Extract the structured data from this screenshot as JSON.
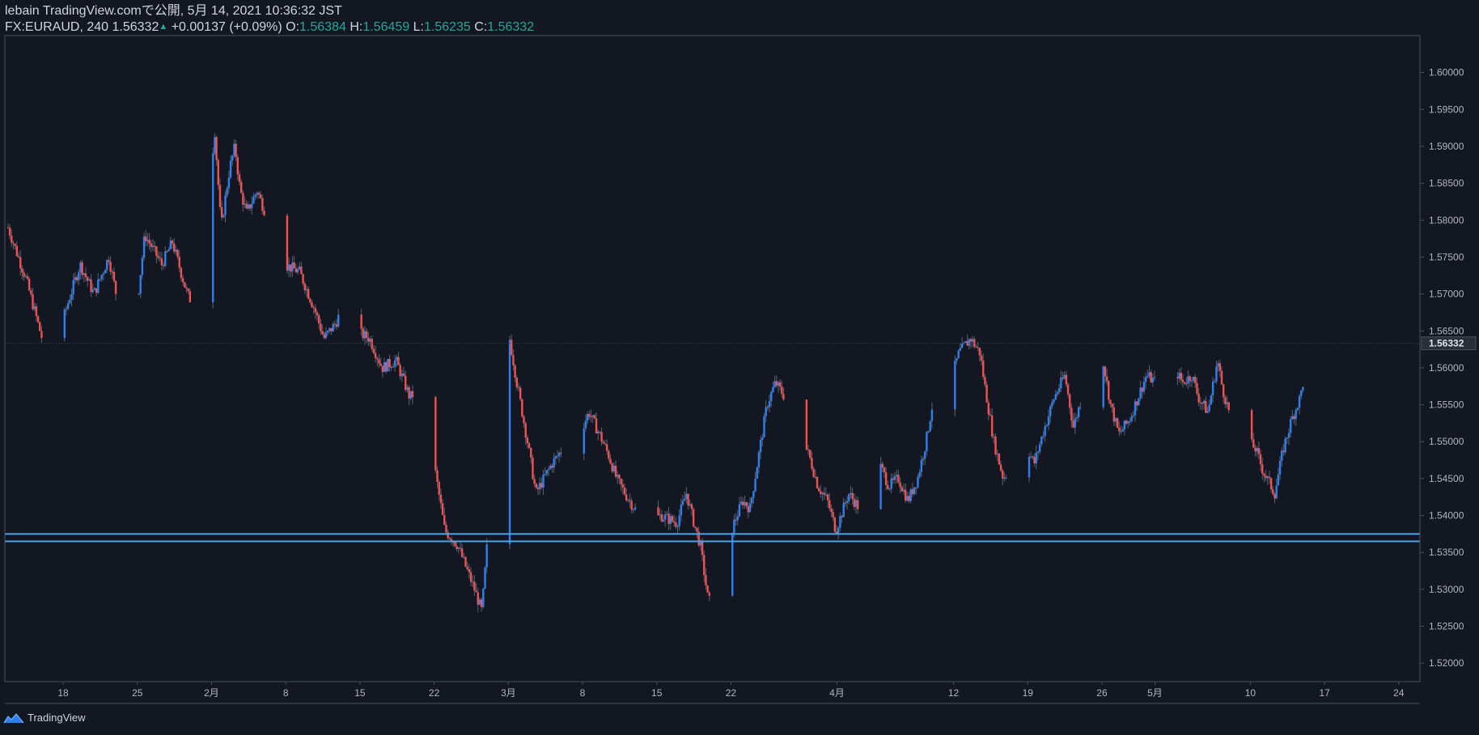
{
  "header": {
    "published": "lebain TradingView.comで公開, 5月 14, 2021 10:36:32 JST",
    "symbol": "FX:EURAUD, 240",
    "last": "1.56332",
    "change": "+0.00137 (+0.09%)",
    "o_label": "O:",
    "o_value": "1.56384",
    "h_label": "H:",
    "h_value": "1.56459",
    "l_label": "L:",
    "l_value": "1.56235",
    "c_label": "C:",
    "c_value": "1.56332"
  },
  "footer": {
    "brand": "TradingView",
    "logo_icon": "tradingview-logo-icon"
  },
  "colors": {
    "background": "#131722",
    "up": "#2f80ed",
    "down": "#ef5350",
    "support_line": "#4ca3e6",
    "axis_text": "#b2b5be",
    "border": "#4a4f5c"
  },
  "chart_data": {
    "type": "candlestick",
    "title": "",
    "ylim": [
      1.5175,
      1.605
    ],
    "y_ticks": [
      "1.60000",
      "1.59500",
      "1.59000",
      "1.58500",
      "1.58000",
      "1.57500",
      "1.57000",
      "1.56500",
      "1.56000",
      "1.55500",
      "1.55000",
      "1.54500",
      "1.54000",
      "1.53500",
      "1.53000",
      "1.52500",
      "1.52000"
    ],
    "last_price_label": "1.56332",
    "last_price": 1.56332,
    "x_ticks": [
      {
        "label": "18",
        "day": 18
      },
      {
        "label": "25",
        "day": 25
      },
      {
        "label": "2月",
        "day": 32
      },
      {
        "label": "8",
        "day": 39
      },
      {
        "label": "15",
        "day": 46
      },
      {
        "label": "22",
        "day": 53
      },
      {
        "label": "3月",
        "day": 60
      },
      {
        "label": "8",
        "day": 67
      },
      {
        "label": "15",
        "day": 74
      },
      {
        "label": "22",
        "day": 81
      },
      {
        "label": "4月",
        "day": 91
      },
      {
        "label": "12",
        "day": 102
      },
      {
        "label": "19",
        "day": 109
      },
      {
        "label": "26",
        "day": 116
      },
      {
        "label": "5月",
        "day": 121
      },
      {
        "label": "10",
        "day": 130
      },
      {
        "label": "17",
        "day": 137
      },
      {
        "label": "24",
        "day": 144
      }
    ],
    "x_domain_days": [
      12.5,
      146.0
    ],
    "support_zone": [
      1.5365,
      1.5375
    ],
    "key_closes": [
      [
        12.8,
        1.579
      ],
      [
        14.5,
        1.572
      ],
      [
        16.0,
        1.564
      ],
      [
        16.7,
        1.56
      ],
      [
        18.5,
        1.569
      ],
      [
        19.6,
        1.574
      ],
      [
        20.9,
        1.57
      ],
      [
        22.3,
        1.575
      ],
      [
        23.7,
        1.565
      ],
      [
        24.2,
        1.561
      ],
      [
        25.0,
        1.569
      ],
      [
        25.7,
        1.578
      ],
      [
        27.3,
        1.574
      ],
      [
        28.3,
        1.577
      ],
      [
        29.7,
        1.57
      ],
      [
        30.1,
        1.569
      ],
      [
        31.1,
        1.577
      ],
      [
        31.8,
        1.585
      ],
      [
        32.3,
        1.592
      ],
      [
        32.9,
        1.579
      ],
      [
        33.7,
        1.587
      ],
      [
        34.2,
        1.59
      ],
      [
        34.7,
        1.584
      ],
      [
        35.3,
        1.581
      ],
      [
        36.3,
        1.584
      ],
      [
        37.6,
        1.579
      ],
      [
        38.9,
        1.574
      ],
      [
        40.3,
        1.573
      ],
      [
        41.7,
        1.568
      ],
      [
        42.6,
        1.564
      ],
      [
        43.7,
        1.566
      ],
      [
        44.9,
        1.57
      ],
      [
        45.5,
        1.565
      ],
      [
        46.9,
        1.564
      ],
      [
        48.1,
        1.56
      ],
      [
        49.4,
        1.561
      ],
      [
        50.7,
        1.556
      ],
      [
        51.5,
        1.557
      ],
      [
        52.4,
        1.553
      ],
      [
        53.1,
        1.546
      ],
      [
        54.0,
        1.538
      ],
      [
        55.2,
        1.536
      ],
      [
        56.8,
        1.53
      ],
      [
        57.5,
        1.527
      ],
      [
        58.1,
        1.538
      ],
      [
        58.8,
        1.548
      ],
      [
        59.4,
        1.558
      ],
      [
        60.0,
        1.565
      ],
      [
        60.8,
        1.558
      ],
      [
        61.8,
        1.55
      ],
      [
        62.6,
        1.543
      ],
      [
        64.1,
        1.547
      ],
      [
        65.1,
        1.549
      ],
      [
        65.9,
        1.546
      ],
      [
        66.7,
        1.551
      ],
      [
        67.6,
        1.554
      ],
      [
        68.6,
        1.551
      ],
      [
        69.5,
        1.548
      ],
      [
        70.2,
        1.545
      ],
      [
        71.0,
        1.543
      ],
      [
        71.9,
        1.541
      ],
      [
        73.0,
        1.539
      ],
      [
        74.4,
        1.54
      ],
      [
        75.9,
        1.539
      ],
      [
        76.8,
        1.543
      ],
      [
        77.5,
        1.539
      ],
      [
        78.1,
        1.536
      ],
      [
        78.9,
        1.528
      ],
      [
        79.8,
        1.534
      ],
      [
        80.6,
        1.536
      ],
      [
        81.3,
        1.539
      ],
      [
        82.1,
        1.542
      ],
      [
        82.8,
        1.541
      ],
      [
        83.6,
        1.548
      ],
      [
        84.4,
        1.555
      ],
      [
        85.2,
        1.558
      ],
      [
        86.1,
        1.556
      ],
      [
        87.3,
        1.552
      ],
      [
        88.4,
        1.548
      ],
      [
        89.2,
        1.544
      ],
      [
        90.1,
        1.542
      ],
      [
        90.9,
        1.538
      ],
      [
        92.1,
        1.543
      ],
      [
        93.1,
        1.541
      ],
      [
        93.8,
        1.544
      ],
      [
        94.3,
        1.552
      ],
      [
        95.0,
        1.547
      ],
      [
        95.9,
        1.544
      ],
      [
        96.8,
        1.545
      ],
      [
        97.7,
        1.542
      ],
      [
        98.6,
        1.545
      ],
      [
        99.4,
        1.55
      ],
      [
        100.6,
        1.56
      ],
      [
        101.7,
        1.558
      ],
      [
        102.5,
        1.562
      ],
      [
        103.6,
        1.564
      ],
      [
        104.5,
        1.562
      ],
      [
        104.9,
        1.558
      ],
      [
        105.8,
        1.55
      ],
      [
        106.7,
        1.545
      ],
      [
        107.6,
        1.547
      ],
      [
        108.7,
        1.55
      ],
      [
        109.6,
        1.547
      ],
      [
        110.4,
        1.551
      ],
      [
        111.5,
        1.556
      ],
      [
        112.5,
        1.559
      ],
      [
        113.3,
        1.552
      ],
      [
        114.1,
        1.556
      ],
      [
        115.2,
        1.559
      ],
      [
        116.1,
        1.561
      ],
      [
        116.8,
        1.555
      ],
      [
        117.6,
        1.551
      ],
      [
        118.6,
        1.553
      ],
      [
        119.4,
        1.556
      ],
      [
        120.2,
        1.559
      ],
      [
        121.1,
        1.558
      ],
      [
        121.9,
        1.555
      ],
      [
        122.8,
        1.56
      ],
      [
        123.6,
        1.558
      ],
      [
        124.5,
        1.559
      ],
      [
        125.1,
        1.556
      ],
      [
        126.0,
        1.554
      ],
      [
        126.9,
        1.561
      ],
      [
        127.4,
        1.557
      ],
      [
        128.2,
        1.553
      ],
      [
        129.0,
        1.551
      ],
      [
        129.8,
        1.55
      ],
      [
        130.5,
        1.549
      ],
      [
        131.2,
        1.546
      ],
      [
        132.3,
        1.543
      ],
      [
        133.1,
        1.549
      ],
      [
        133.9,
        1.553
      ],
      [
        134.7,
        1.556
      ],
      [
        135.4,
        1.561
      ],
      [
        136.0,
        1.565
      ],
      [
        136.9,
        1.563
      ]
    ]
  }
}
